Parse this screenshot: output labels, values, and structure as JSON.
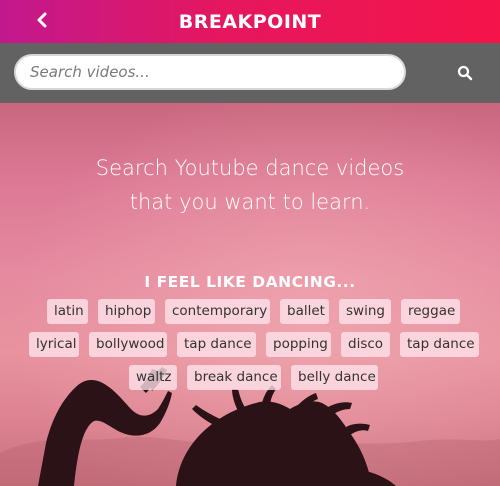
{
  "header": {
    "brand": "BREAKPOINT",
    "back_icon": "chevron-left-icon",
    "brand_colors": [
      "#c2188e",
      "#f5144a"
    ]
  },
  "search": {
    "placeholder": "Search videos...",
    "value": "",
    "button_icon": "search-icon"
  },
  "hero": {
    "headline_line1": "Search Youtube dance videos",
    "headline_line2": "that you want to learn.",
    "subheading": "I FEEL LIKE DANCING..."
  },
  "tags": [
    "latin",
    "hiphop",
    "contemporary",
    "ballet",
    "swing",
    "reggae",
    "lyrical",
    "bollywood",
    "tap dance",
    "popping",
    "disco",
    "tap dance",
    "waltz",
    "break dance",
    "belly dance"
  ]
}
